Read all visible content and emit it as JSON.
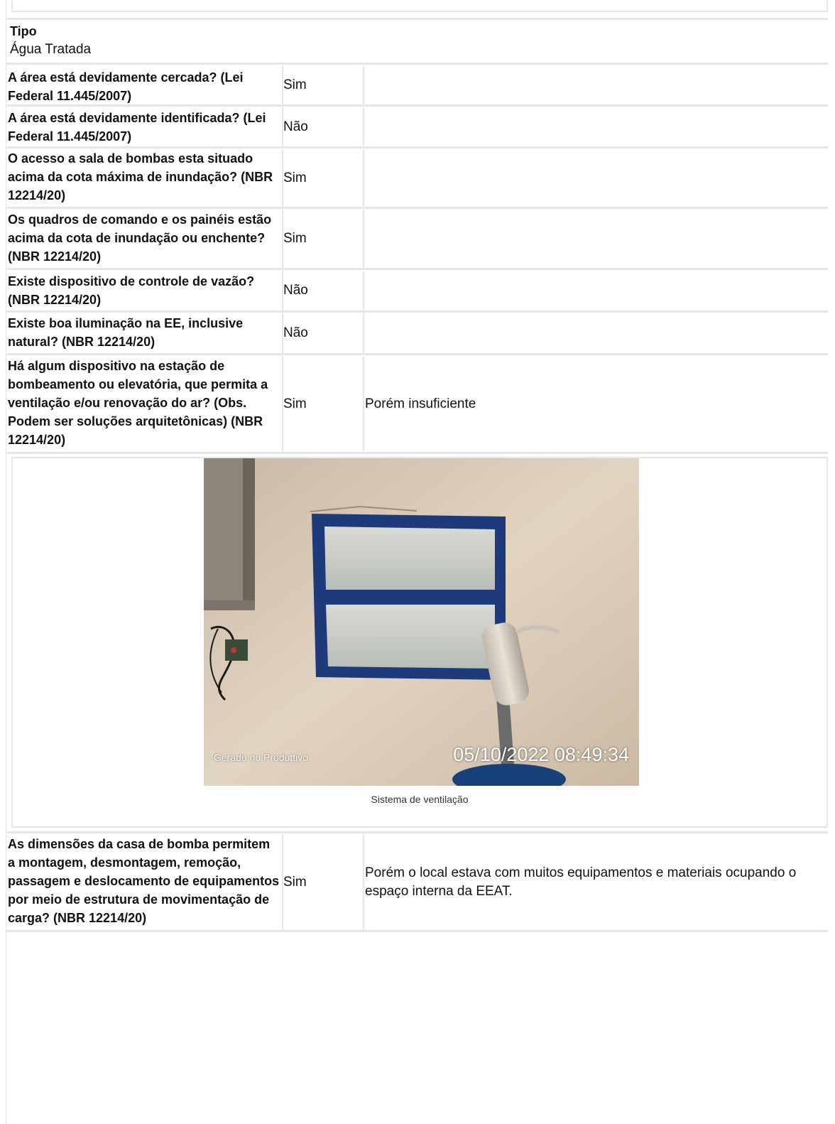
{
  "tipo": {
    "label": "Tipo",
    "value": "Água Tratada"
  },
  "rows": [
    {
      "question": "A área está devidamente cercada? (Lei Federal 11.445/2007)",
      "answer": "Sim",
      "note": ""
    },
    {
      "question": "A área está devidamente identificada? (Lei Federal 11.445/2007)",
      "answer": "Não",
      "note": ""
    },
    {
      "question": "O acesso a sala de bombas esta situado acima da cota máxima de inundação? (NBR 12214/20)",
      "answer": "Sim",
      "note": ""
    },
    {
      "question": "Os quadros de comando e os painéis estão acima da cota de inundação ou enchente? (NBR 12214/20)",
      "answer": "Sim",
      "note": ""
    },
    {
      "question": "Existe dispositivo de controle de vazão? (NBR 12214/20)",
      "answer": "Não",
      "note": ""
    },
    {
      "question": "Existe boa iluminação na EE, inclusive natural? (NBR 12214/20)",
      "answer": "Não",
      "note": ""
    },
    {
      "question": "Há algum dispositivo na estação de bombeamento ou elevatória, que permita a ventilação e/ou renovação do ar? (Obs. Podem ser soluções arquitetônicas) (NBR 12214/20)",
      "answer": "Sim",
      "note": "Porém insuficiente"
    },
    {
      "question": "As dimensões da casa de bomba permitem a montagem, desmontagem, remoção, passagem e deslocamento de equipamentos por meio de estrutura de movimentação de carga? (NBR 12214/20)",
      "answer": "Sim",
      "note": "Porém o local estava com muitos equipamentos e materiais ocupando o espaço interna da EEAT."
    }
  ],
  "photo": {
    "watermark_left": "Gerado no Produttivo",
    "watermark_right": "05/10/2022 08:49:34",
    "caption": "Sistema de ventilação"
  },
  "colors": {
    "rule": "#e6e6e6",
    "wall": "#d9c9b6",
    "window_frame": "#1d3a7a"
  }
}
